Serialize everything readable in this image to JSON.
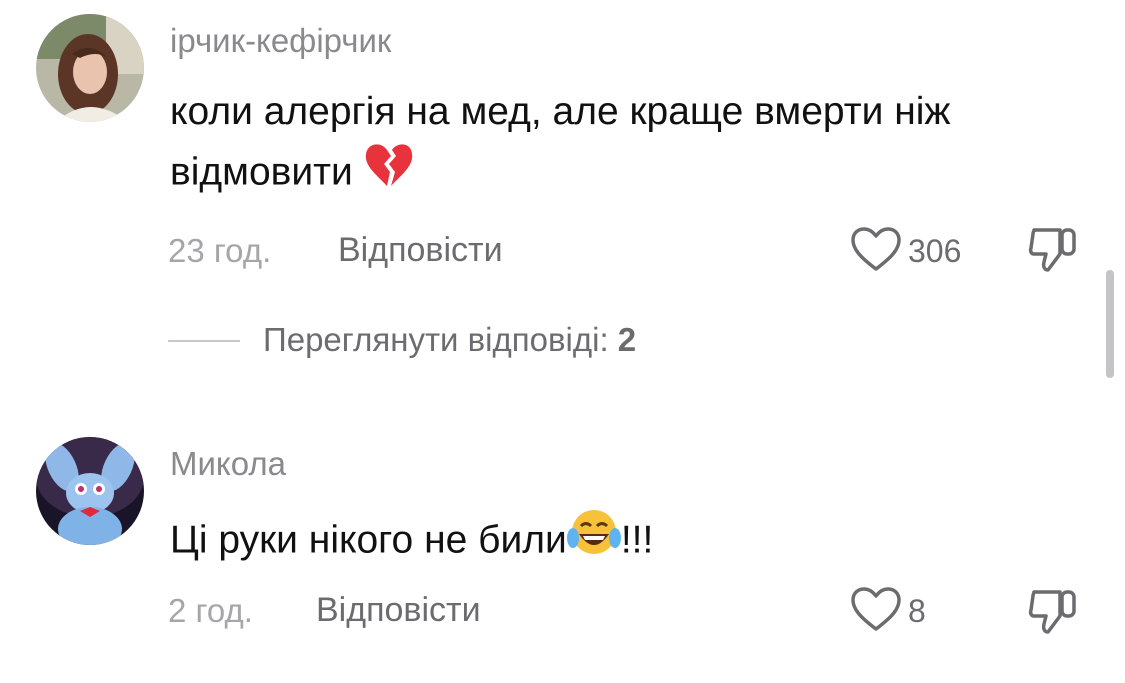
{
  "comments": [
    {
      "username": "ірчик-кефірчик",
      "text_line1": "коли алергія на мед, але краще вмерти ніж",
      "text_line2": "відмовити",
      "emoji": "broken-heart",
      "time": "23 год.",
      "reply_label": "Відповісти",
      "likes": "306",
      "view_replies_label": "Переглянути відповіді:",
      "view_replies_count": "2"
    },
    {
      "username": "Микола",
      "text": "Ці руки нікого не били",
      "emoji": "tears-of-joy",
      "text_suffix": "!!!",
      "time": "2 год.",
      "reply_label": "Відповісти",
      "likes": "8"
    }
  ],
  "icons": {
    "like": "heart-outline-icon",
    "dislike": "thumbs-down-outline-icon"
  },
  "colors": {
    "username": "#8a8a8e",
    "text": "#111111",
    "meta": "#a6a6aa",
    "action": "#6c6c70",
    "broken_heart": "#e8323c",
    "emoji_yellow": "#f7c23a",
    "scrollbar": "#c4c4c6"
  }
}
